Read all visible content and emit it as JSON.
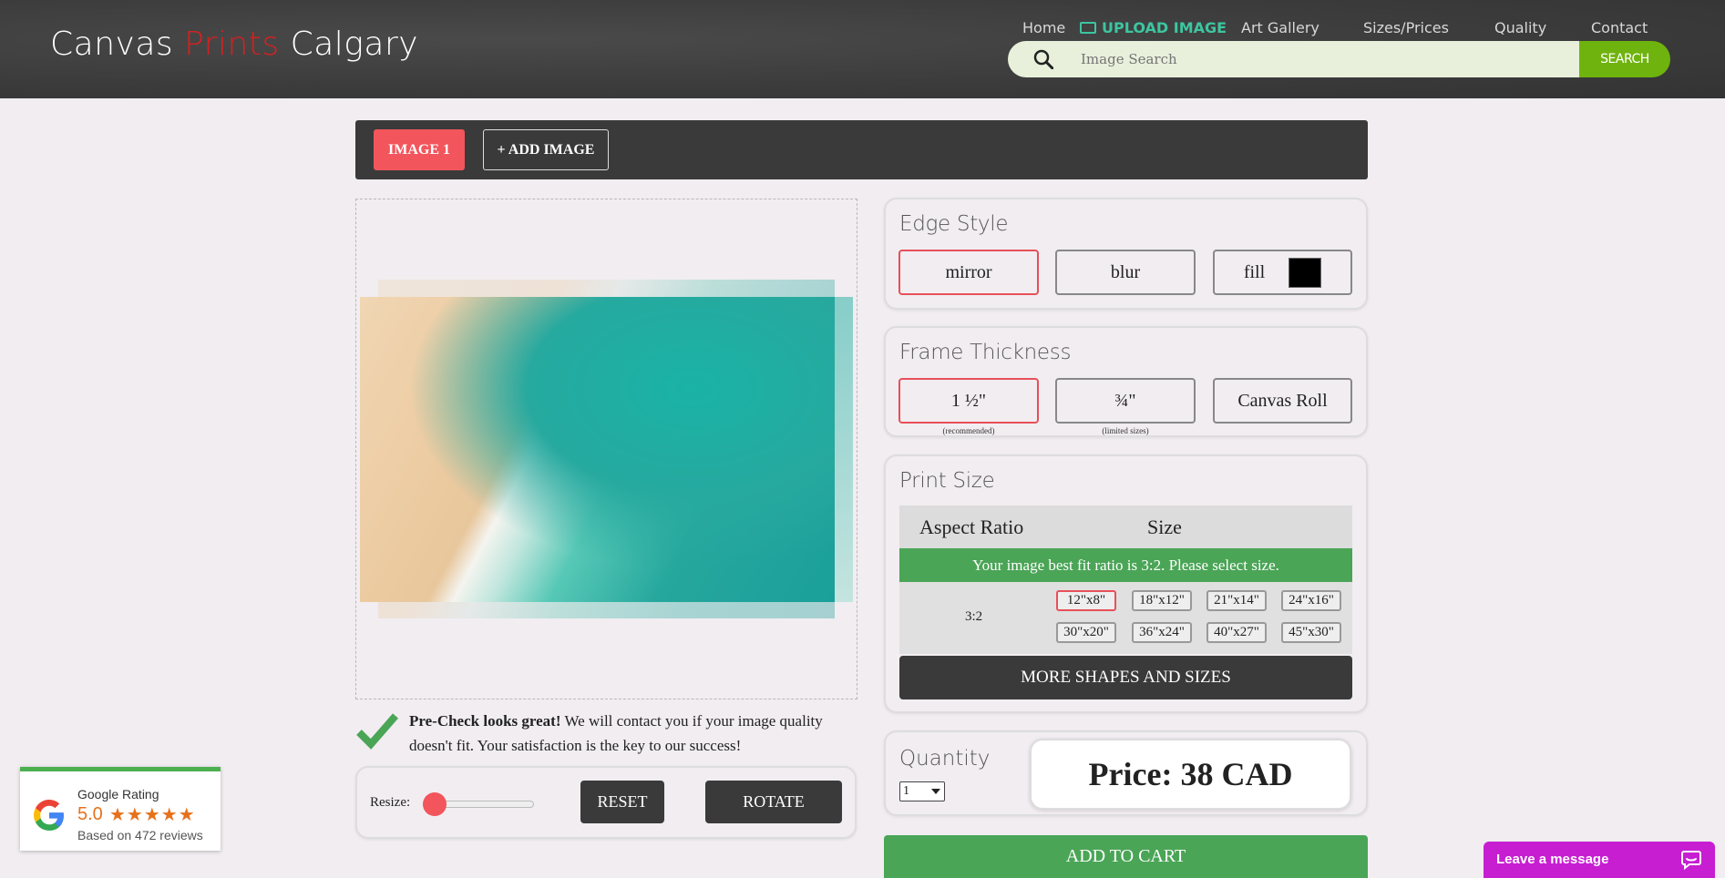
{
  "header": {
    "logo_part1": "Canvas ",
    "logo_accent": "Prints",
    "logo_part3": " Calgary",
    "nav": {
      "home": "Home",
      "upload": "UPLOAD IMAGE",
      "gallery": "Art Gallery",
      "sizes": "Sizes/Prices",
      "quality": "Quality",
      "contact": "Contact"
    },
    "search_placeholder": "Image Search",
    "search_button": "SEARCH"
  },
  "tabs": {
    "image1": "IMAGE 1",
    "add_image": "+ ADD IMAGE"
  },
  "precheck": {
    "bold": "Pre-Check looks great!",
    "text": " We will contact you if your image quality doesn't fit. Your satisfaction is the key to our success!"
  },
  "resize": {
    "label": "Resize:",
    "reset": "RESET",
    "rotate": "ROTATE"
  },
  "edge_style": {
    "title": "Edge Style",
    "options": [
      "mirror",
      "blur",
      "fill"
    ],
    "selected": "mirror",
    "fill_color": "#000000"
  },
  "frame_thickness": {
    "title": "Frame Thickness",
    "options": [
      "1 ½\"",
      "¾\"",
      "Canvas Roll"
    ],
    "notes": [
      "(recommended)",
      "(limited sizes)"
    ],
    "selected": "1 ½\""
  },
  "print_size": {
    "title": "Print Size",
    "col_ratio": "Aspect Ratio",
    "col_size": "Size",
    "banner": "Your image best fit ratio is 3:2. Please select size.",
    "ratio": "3:2",
    "sizes": [
      "12\"x8\"",
      "18\"x12\"",
      "21\"x14\"",
      "24\"x16\"",
      "30\"x20\"",
      "36\"x24\"",
      "40\"x27\"",
      "45\"x30\""
    ],
    "selected": "12\"x8\"",
    "more": "MORE SHAPES AND SIZES"
  },
  "quantity": {
    "title": "Quantity",
    "value": "1",
    "price": "Price: 38 CAD"
  },
  "add_to_cart": "ADD TO CART",
  "google": {
    "title": "Google Rating",
    "score": "5.0",
    "stars": "★★★★★",
    "reviews": "Based on 472 reviews"
  },
  "chat": {
    "label": "Leave a message"
  },
  "colors": {
    "accent_red": "#f2555c",
    "green": "#4aa556",
    "search_green": "#6fb30e",
    "chat_purple": "#c71ed2",
    "dark": "#3a3a3a"
  }
}
